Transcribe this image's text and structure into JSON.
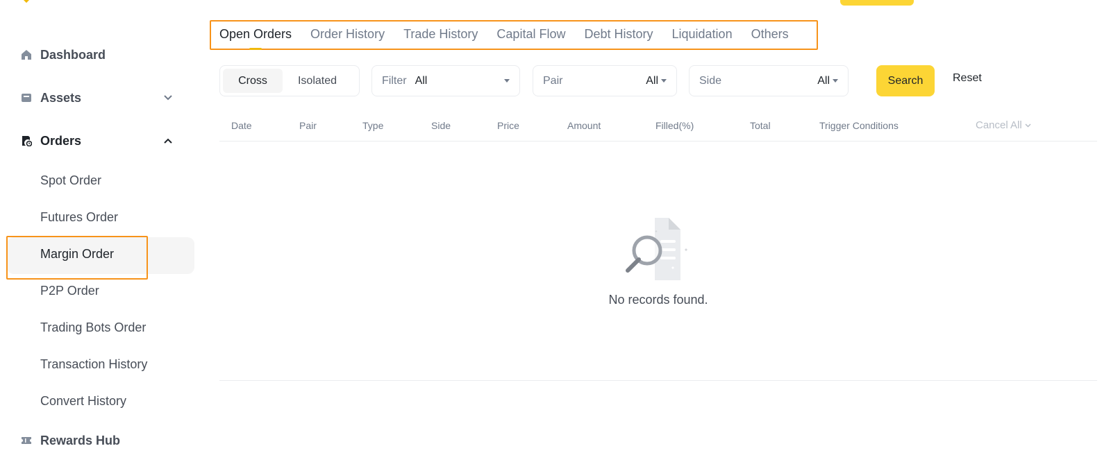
{
  "sidebar": {
    "items": [
      {
        "label": "Dashboard",
        "icon": "home-icon"
      },
      {
        "label": "Assets",
        "icon": "wallet-icon"
      },
      {
        "label": "Orders",
        "icon": "orders-icon"
      },
      {
        "label": "Rewards Hub",
        "icon": "ticket-icon"
      }
    ],
    "orders_sub": [
      {
        "label": "Spot Order"
      },
      {
        "label": "Futures Order"
      },
      {
        "label": "Margin Order"
      },
      {
        "label": "P2P Order"
      },
      {
        "label": "Trading Bots Order"
      },
      {
        "label": "Transaction History"
      },
      {
        "label": "Convert History"
      }
    ]
  },
  "tabs": [
    "Open Orders",
    "Order History",
    "Trade History",
    "Capital Flow",
    "Debt History",
    "Liquidation",
    "Others"
  ],
  "filters": {
    "segment": [
      "Cross",
      "Isolated"
    ],
    "filter_label": "Filter",
    "filter_value": "All",
    "pair_label": "Pair",
    "pair_value": "All",
    "side_label": "Side",
    "side_value": "All",
    "search_label": "Search",
    "reset_label": "Reset"
  },
  "table": {
    "headers": [
      "Date",
      "Pair",
      "Type",
      "Side",
      "Price",
      "Amount",
      "Filled(%)",
      "Total",
      "Trigger Conditions"
    ],
    "cancel_all": "Cancel All"
  },
  "empty": {
    "text": "No records found."
  },
  "colors": {
    "accent": "#fcd535",
    "highlight": "#f7931a",
    "brand": "#f0b90b"
  }
}
